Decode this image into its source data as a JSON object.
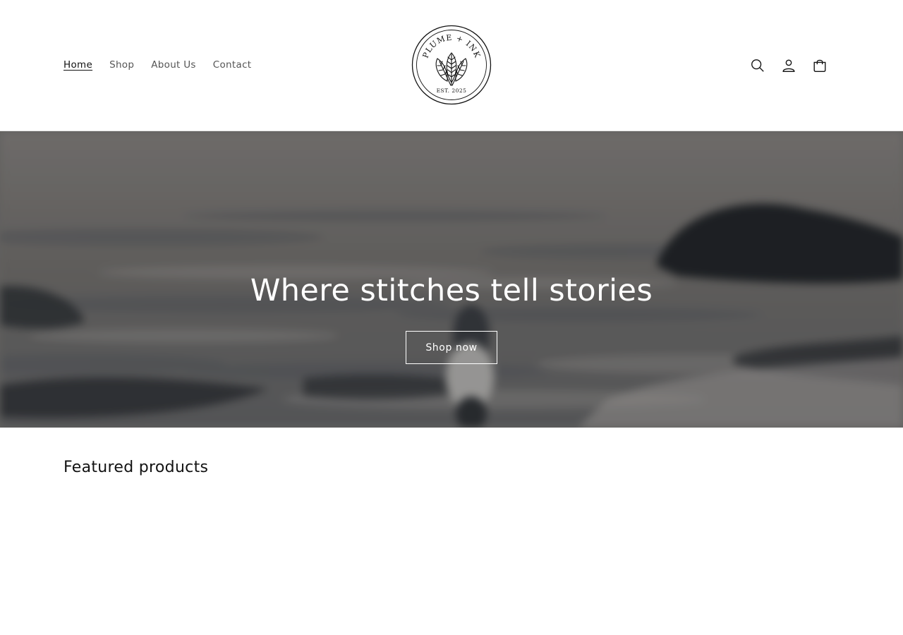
{
  "nav": {
    "items": [
      {
        "label": "Home",
        "active": true
      },
      {
        "label": "Shop",
        "active": false
      },
      {
        "label": "About Us",
        "active": false
      },
      {
        "label": "Contact",
        "active": false
      }
    ]
  },
  "logo": {
    "top_text": "PLUME + INK",
    "bottom_text": "EST. 2025"
  },
  "header_icons": [
    "search-icon",
    "account-icon",
    "cart-icon"
  ],
  "hero": {
    "heading": "Where stitches tell stories",
    "button_label": "Shop now"
  },
  "featured": {
    "title": "Featured products"
  },
  "colors": {
    "text": "#121212",
    "nav_text": "#555555",
    "hero_text": "#ffffff",
    "background": "#ffffff"
  }
}
